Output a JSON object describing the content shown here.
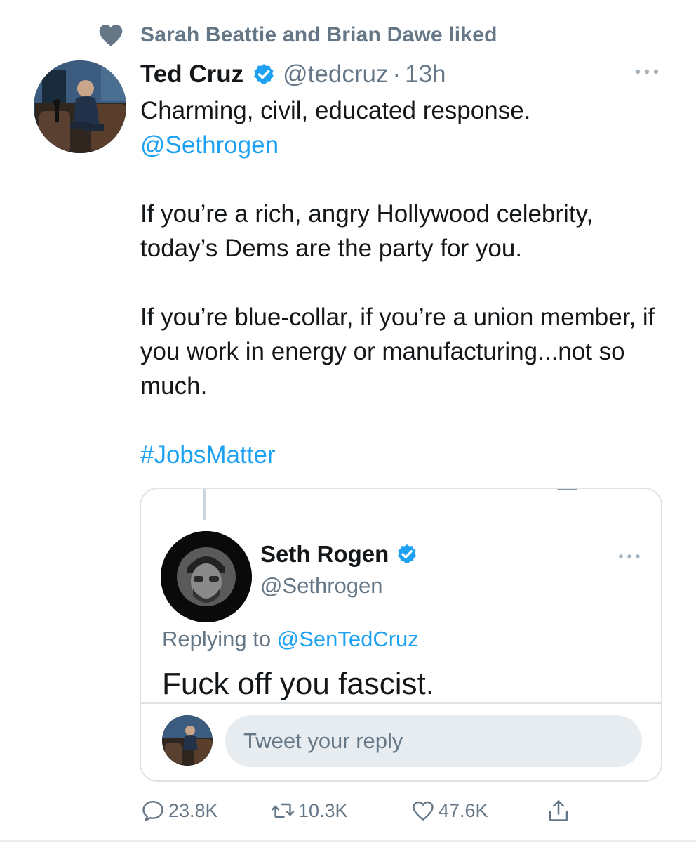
{
  "social_context": {
    "text": "Sarah Beattie and Brian Dawe liked",
    "icon": "heart-icon"
  },
  "tweet": {
    "author_name": "Ted Cruz",
    "author_handle": "@tedcruz",
    "separator": "·",
    "time": "13h",
    "body_line1": "Charming, civil, educated response.",
    "body_mention": "@Sethrogen",
    "body_para2": "If you’re a rich, angry Hollywood celebrity, today’s Dems are the party for you.",
    "body_para3": "If you’re blue-collar, if you’re a union member, if you work in energy or manufacturing...not so much.",
    "hashtag": "#JobsMatter"
  },
  "embedded": {
    "author_name": "Seth Rogen",
    "author_handle": "@Sethrogen",
    "replying_prefix": "Replying to ",
    "replying_to": "@SenTedCruz",
    "text": "Fuck off you fascist.",
    "reply_placeholder": "Tweet your reply"
  },
  "actions": {
    "replies": "23.8K",
    "retweets": "10.3K",
    "likes": "47.6K",
    "icons": [
      "comment-icon",
      "retweet-icon",
      "like-icon",
      "share-icon"
    ]
  },
  "colors": {
    "link": "#1da1f2",
    "secondary_text": "#657786",
    "primary_text": "#14171a",
    "verified": "#1da1f2",
    "border": "#dfe3e8",
    "input_bg": "#e6ecf0"
  }
}
